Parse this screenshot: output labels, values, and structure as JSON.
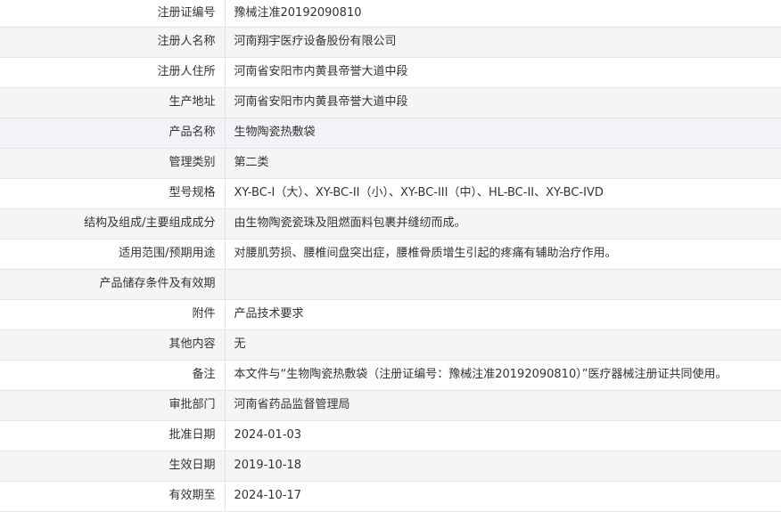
{
  "rows": [
    {
      "label": "注册证编号",
      "value": "豫械注准20192090810"
    },
    {
      "label": "注册人名称",
      "value": "河南翔宇医疗设备股份有限公司"
    },
    {
      "label": "注册人住所",
      "value": "河南省安阳市内黄县帝誉大道中段"
    },
    {
      "label": "生产地址",
      "value": "河南省安阳市内黄县帝誉大道中段"
    },
    {
      "label": "产品名称",
      "value": "生物陶瓷热敷袋"
    },
    {
      "label": "管理类别",
      "value": "第二类"
    },
    {
      "label": "型号规格",
      "value": "XY-BC-I（大）、XY-BC-II（小）、XY-BC-III（中）、HL-BC-II、XY-BC-IVD"
    },
    {
      "label": "结构及组成/主要组成成分",
      "value": "由生物陶瓷瓷珠及阻燃面料包裹并缝纫而成。"
    },
    {
      "label": "适用范围/预期用途",
      "value": "对腰肌劳损、腰椎间盘突出症，腰椎骨质增生引起的疼痛有辅助治疗作用。"
    },
    {
      "label": "产品储存条件及有效期",
      "value": ""
    },
    {
      "label": "附件",
      "value": "产品技术要求"
    },
    {
      "label": "其他内容",
      "value": "无"
    },
    {
      "label": "备注",
      "value": "本文件与“生物陶瓷热敷袋（注册证编号：豫械注准20192090810）”医疗器械注册证共同使用。"
    },
    {
      "label": "审批部门",
      "value": "河南省药品监督管理局"
    },
    {
      "label": "批准日期",
      "value": "2024-01-03"
    },
    {
      "label": "生效日期",
      "value": "2019-10-18"
    },
    {
      "label": "有效期至",
      "value": "2024-10-17"
    }
  ]
}
